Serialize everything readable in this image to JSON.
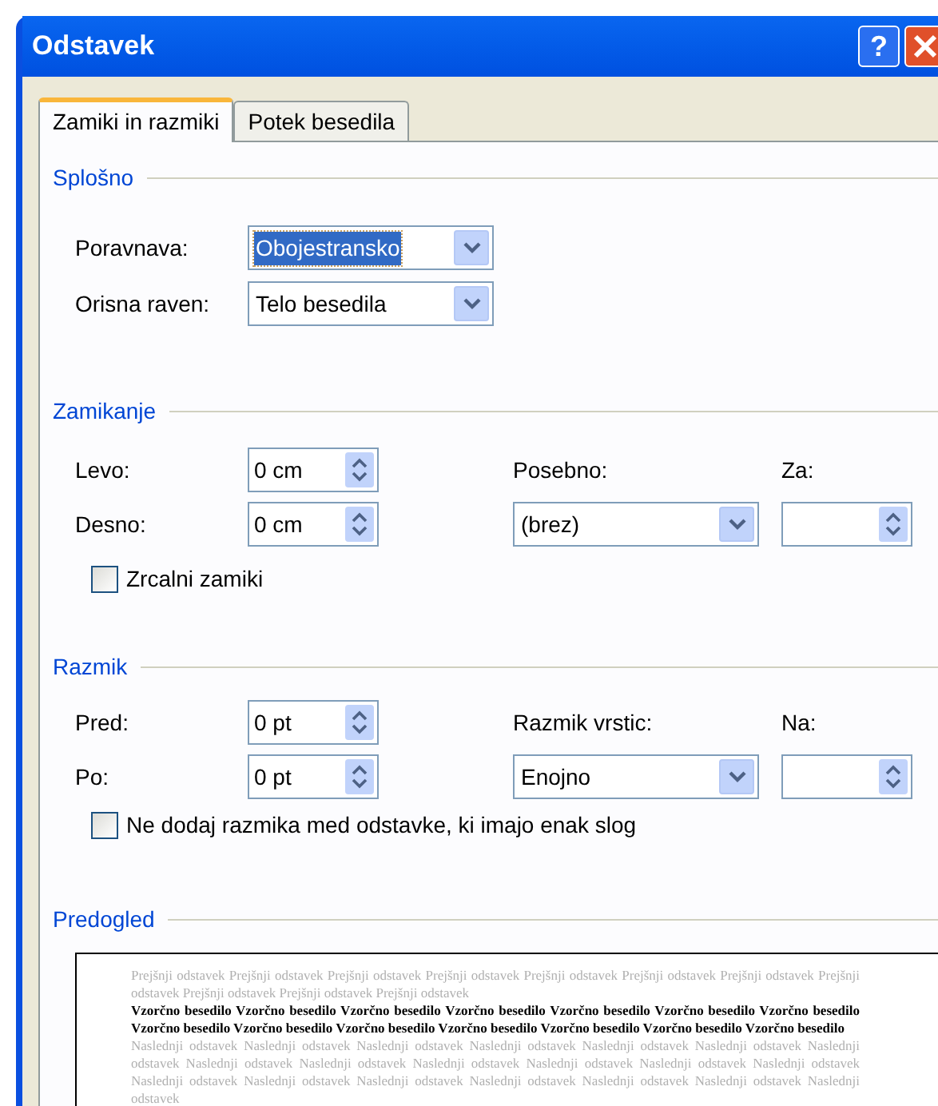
{
  "window": {
    "title": "Odstavek",
    "help": "?"
  },
  "tabs": [
    {
      "label": "Zamiki in razmiki",
      "selected": true
    },
    {
      "label": "Potek besedila",
      "selected": false
    }
  ],
  "general": {
    "title": "Splošno",
    "alignment": {
      "label": "Poravnava:",
      "value": "Obojestransko",
      "highlighted": true
    },
    "outline_level": {
      "label": "Orisna raven:",
      "value": "Telo besedila",
      "highlighted": false
    }
  },
  "indentation": {
    "title": "Zamikanje",
    "left": {
      "label": "Levo:",
      "value": "0 cm"
    },
    "right": {
      "label": "Desno:",
      "value": "0 cm"
    },
    "special": {
      "label": "Posebno:",
      "value": "(brez)"
    },
    "by": {
      "label": "Za:"
    },
    "mirror": {
      "label": "Zrcalni zamiki",
      "checked": false
    }
  },
  "spacing": {
    "title": "Razmik",
    "before": {
      "label": "Pred:",
      "value": "0 pt"
    },
    "after": {
      "label": "Po:",
      "value": "0 pt"
    },
    "line_spacing": {
      "label": "Razmik vrstic:",
      "value": "Enojno"
    },
    "at": {
      "label": "Na:"
    },
    "dont_add": {
      "label": "Ne dodaj razmika med odstavke, ki imajo enak slog",
      "checked": false
    }
  },
  "preview": {
    "title": "Predogled",
    "previous": "Prejšnji odstavek Prejšnji odstavek Prejšnji odstavek Prejšnji odstavek Prejšnji odstavek Prejšnji odstavek Prejšnji odstavek Prejšnji odstavek Prejšnji odstavek Prejšnji odstavek Prejšnji odstavek",
    "sample": "Vzorčno besedilo Vzorčno besedilo Vzorčno besedilo Vzorčno besedilo Vzorčno besedilo Vzorčno besedilo Vzorčno besedilo Vzorčno besedilo Vzorčno besedilo Vzorčno besedilo Vzorčno besedilo Vzorčno besedilo Vzorčno besedilo Vzorčno besedilo",
    "next": "Naslednji odstavek Naslednji odstavek Naslednji odstavek Naslednji odstavek Naslednji odstavek Naslednji odstavek Naslednji odstavek Naslednji odstavek Naslednji odstavek Naslednji odstavek Naslednji odstavek Naslednji odstavek Naslednji odstavek Naslednji odstavek Naslednji odstavek Naslednji odstavek Naslednji odstavek Naslednji odstavek Naslednji odstavek Naslednji odstavek"
  }
}
